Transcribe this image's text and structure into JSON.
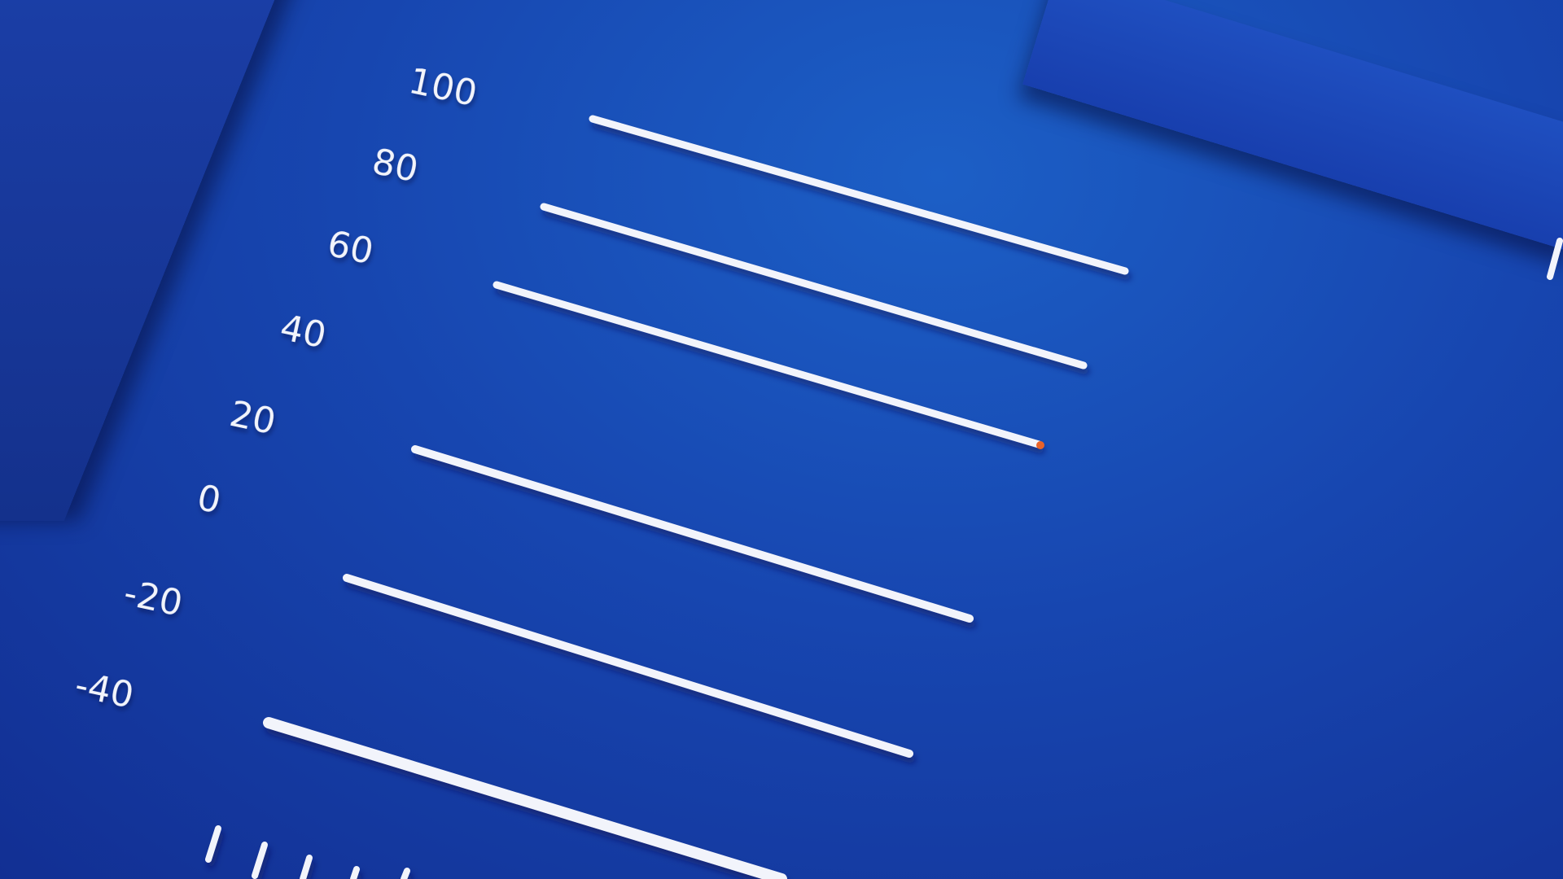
{
  "scale": {
    "labels": [
      "100",
      "80",
      "60",
      "40",
      "20",
      "0",
      "-20",
      "-40"
    ]
  },
  "colors": {
    "background": "#1746b0",
    "bar": "#f2f4fb",
    "accent": "#e8632a"
  }
}
